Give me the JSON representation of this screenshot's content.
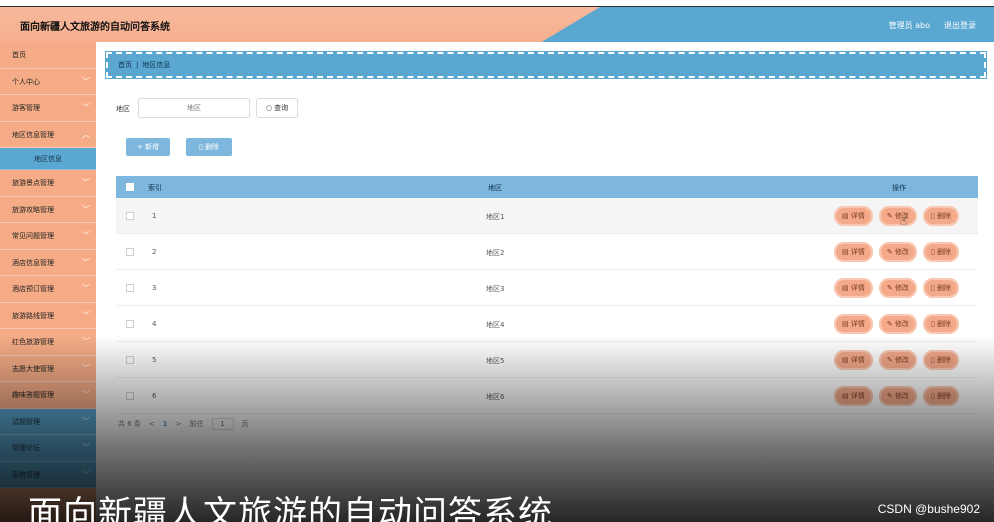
{
  "header": {
    "title": "面向新疆人文旅游的自动问答系统",
    "user": "管理员 abo",
    "logout": "退出登录"
  },
  "sidebar": {
    "items": [
      {
        "label": "首页"
      },
      {
        "label": "个人中心"
      },
      {
        "label": "游客管理"
      },
      {
        "label": "地区信息管理"
      },
      {
        "label": "地区信息"
      },
      {
        "label": "旅游景点管理"
      },
      {
        "label": "旅游攻略管理"
      },
      {
        "label": "常见问题管理"
      },
      {
        "label": "酒店信息管理"
      },
      {
        "label": "酒店预订管理"
      },
      {
        "label": "旅游路线管理"
      },
      {
        "label": "红色旅游管理"
      },
      {
        "label": "志愿大使管理"
      },
      {
        "label": "趣味答题管理"
      },
      {
        "label": "试题管理"
      },
      {
        "label": "管理论坛"
      },
      {
        "label": "系统管理"
      }
    ]
  },
  "breadcrumb": {
    "home": "首页",
    "sep": "|",
    "current": "地区信息"
  },
  "search": {
    "label": "地区",
    "placeholder": "地区",
    "button": "查询"
  },
  "actions": {
    "add": "+ 新增",
    "delete": "删除"
  },
  "table": {
    "headers": {
      "index": "索引",
      "area": "地区",
      "ops": "操作"
    },
    "rows": [
      {
        "index": "1",
        "area": "地区1"
      },
      {
        "index": "2",
        "area": "地区2"
      },
      {
        "index": "3",
        "area": "地区3"
      },
      {
        "index": "4",
        "area": "地区4"
      },
      {
        "index": "5",
        "area": "地区5"
      },
      {
        "index": "6",
        "area": "地区6"
      }
    ],
    "op_labels": {
      "detail": "详情",
      "edit": "修改",
      "delete": "删除"
    }
  },
  "pagination": {
    "total": "共 6 条",
    "prev": "<",
    "current": "1",
    "next": ">",
    "goto": "前往",
    "page_value": "1",
    "page_unit": "页"
  },
  "caption": "面向新疆人文旅游的自动问答系统",
  "watermark": "CSDN @bushe902",
  "colors": {
    "peach": "#f5ac86",
    "blue": "#5aa7d1",
    "light_blue": "#7db7dd"
  }
}
